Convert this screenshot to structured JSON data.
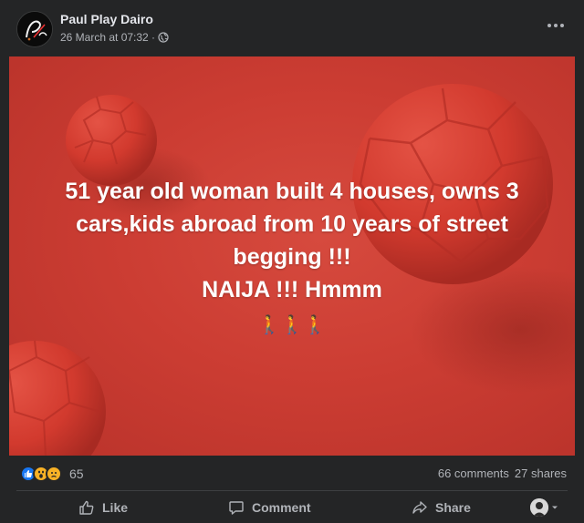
{
  "post": {
    "author": "Paul Play Dairo",
    "timestamp": "26 March at 07:32 ·",
    "privacy_icon": "globe-icon",
    "more_icon": "more-options-icon"
  },
  "image": {
    "text_lines": [
      "51 year old woman built 4 houses, owns 3",
      "cars,kids abroad from 10 years of street",
      "begging !!!",
      "NAIJA !!! Hmmm"
    ],
    "emoji": "🚶🚶🚶",
    "background_color": "#cc3d33",
    "ball_color": "#d5372c"
  },
  "stats": {
    "reaction_icons": [
      "like-reaction",
      "wow-reaction",
      "sad-reaction"
    ],
    "reaction_count": "65",
    "comments": "66 comments",
    "shares": "27 shares"
  },
  "actions": {
    "like": "Like",
    "comment": "Comment",
    "share": "Share"
  },
  "colors": {
    "background": "#242526",
    "text_primary": "#e4e6eb",
    "text_secondary": "#b0b3b8",
    "like_blue": "#1877f2",
    "reaction_yellow": "#f7b125"
  }
}
